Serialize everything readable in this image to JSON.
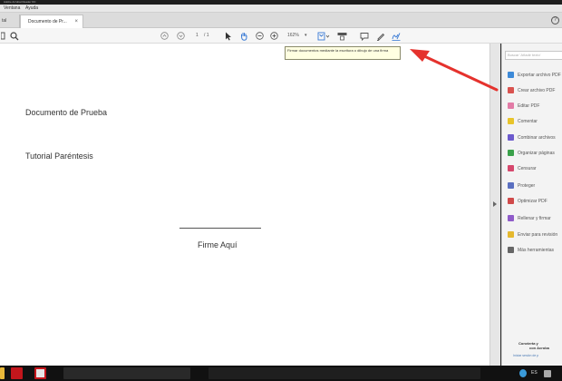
{
  "titlebar": {
    "text": "Adobe Acrobat Reader DC"
  },
  "menu": {
    "items": [
      "Ventana",
      "Ayuda"
    ]
  },
  "tabs": {
    "left": "tal",
    "active": "Documento de Pr...",
    "close_glyph": "×"
  },
  "toolbar": {
    "page_current": "1",
    "page_total": "/ 1",
    "zoom": "162%",
    "zoom_dropdown_glyph": "▾"
  },
  "tooltip": {
    "text": "Firmar documentos mediante la escritura o dibujo de una firma"
  },
  "document": {
    "line1": "Documento de Prueba",
    "line2": "Tutorial Paréntesis",
    "signature_label": "Firme Aquí"
  },
  "right_pane": {
    "search_placeholder": "Buscar 'Añadir texto'",
    "items": [
      {
        "label": "Exportar archivo PDF",
        "color": "#3d8ad8"
      },
      {
        "label": "Crear archivo PDF",
        "color": "#d9534f"
      },
      {
        "label": "Editar PDF",
        "color": "#e27ba6"
      },
      {
        "label": "Comentar",
        "color": "#e8c42a"
      },
      {
        "label": "Combinar archivos",
        "color": "#6c5acd"
      },
      {
        "label": "Organizar páginas",
        "color": "#3aa14a"
      },
      {
        "label": "Censurar",
        "color": "#d6486d"
      },
      {
        "label": "Proteger",
        "color": "#5a6fc0"
      },
      {
        "label": "Optimizar PDF",
        "color": "#d04a4a"
      },
      {
        "label": "Rellenar y firmar",
        "color": "#8f5bc9"
      },
      {
        "label": "Enviar para revisión",
        "color": "#e5b82e"
      },
      {
        "label": "Más herramientas",
        "color": "#666666"
      }
    ],
    "footer_line1": "Convierta y",
    "footer_line2": "con Acroba",
    "footer_link": "Iniciar sesión de p"
  },
  "taskbar": {
    "tray_lang": "ES",
    "colors": {
      "acrobat": "#c4161c"
    }
  },
  "colors": {
    "annotation_arrow": "#e5322d",
    "tooltip_bg": "#ffffe1"
  }
}
